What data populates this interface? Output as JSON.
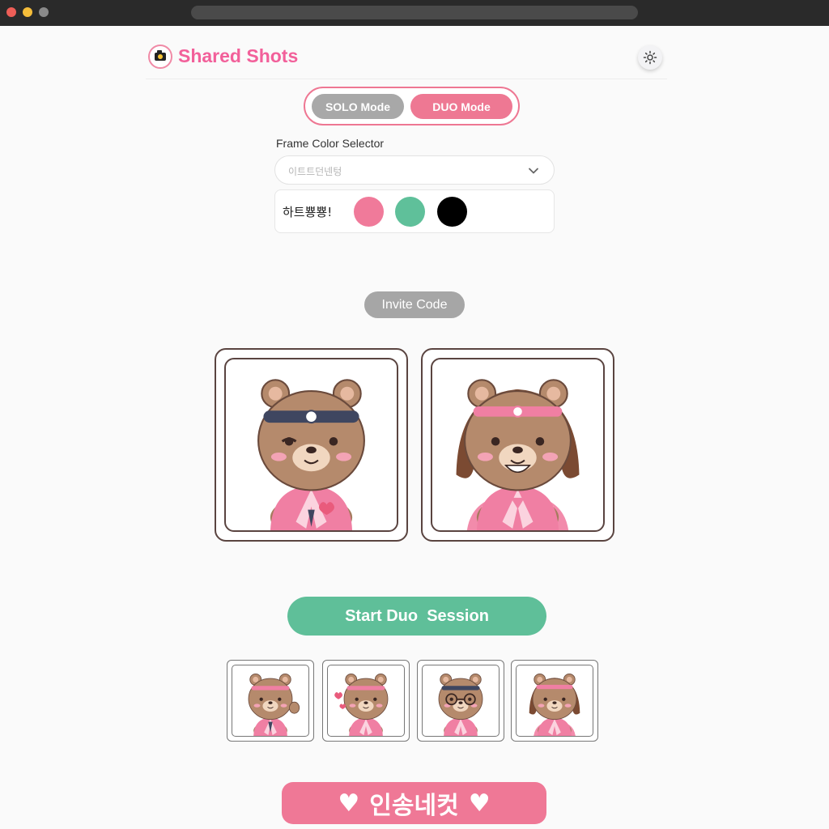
{
  "header": {
    "title": "Shared Shots",
    "logo_icon": "camera-icon",
    "theme_icon": "sun-icon"
  },
  "mode": {
    "solo_label": "SOLO Mode",
    "duo_label": "DUO Mode",
    "selected": "DUO Mode"
  },
  "frame_selector": {
    "label": "Frame Color Selector",
    "value": "이트트던넨텅",
    "swatch_label": "하트뿅뿅!",
    "swatches": [
      "#f07a9a",
      "#5fc09a",
      "#000000"
    ]
  },
  "invite": {
    "label": "Invite Code"
  },
  "preview": {
    "characters": [
      "bear-headband-icon",
      "bear-girl-hanbok-icon"
    ]
  },
  "session": {
    "start_label": "Start Duo  Session"
  },
  "thumbnails": [
    "bear-waving-icon",
    "bear-kiss-icon",
    "bear-glasses-icon",
    "bear-girl-icon"
  ],
  "banner": {
    "label": "인송네컷",
    "heart_left": "♥",
    "heart_right": "♥"
  },
  "colors": {
    "brand_pink": "#f2609a",
    "duo_pink": "#ee7893",
    "start_green": "#5fbf99",
    "frame_brown": "#5a4440"
  }
}
